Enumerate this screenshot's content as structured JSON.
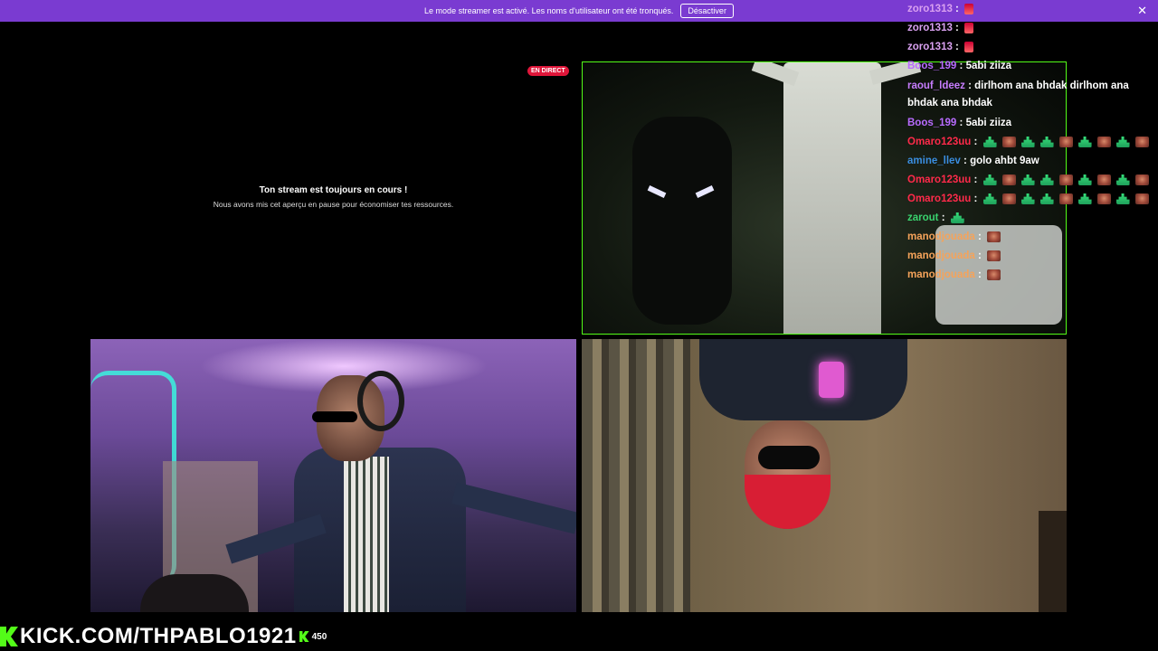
{
  "banner": {
    "text": "Le mode streamer est activé. Les noms d'utilisateur ont été tronqués.",
    "button": "Désactiver",
    "close": "✕",
    "color": "#7a3bd1"
  },
  "live_badge": "EN DIRECT",
  "paused": {
    "title": "Ton stream est toujours en cours !",
    "subtitle": "Nous avons mis cet aperçu en pause pour économiser tes ressources."
  },
  "chat": {
    "messages": [
      {
        "user": "zoro1313",
        "color": "#d9a0f0",
        "text": "",
        "emotes": [
          "red"
        ]
      },
      {
        "user": "zoro1313",
        "color": "#d9a0f0",
        "text": "",
        "emotes": [
          "red"
        ]
      },
      {
        "user": "zoro1313",
        "color": "#d9a0f0",
        "text": "",
        "emotes": [
          "red"
        ]
      },
      {
        "user": "Boos_199",
        "color": "#b86bff",
        "text": "5abi ziiza",
        "emotes": []
      },
      {
        "user": "raouf_ldeez",
        "color": "#c77dff",
        "text": "dirlhom ana bhdak dirlhom ana bhdak ana bhdak",
        "emotes": [],
        "wrap": true
      },
      {
        "user": "Boos_199",
        "color": "#b86bff",
        "text": "5abi ziiza",
        "emotes": []
      },
      {
        "user": "Omaro123uu",
        "color": "#ff2a4a",
        "text": "",
        "emotes": [
          "green",
          "face",
          "green",
          "green",
          "face",
          "green",
          "face",
          "green",
          "face"
        ]
      },
      {
        "user": "amine_llev",
        "color": "#3a8ddf",
        "text": "golo ahbt 9aw",
        "emotes": []
      },
      {
        "user": "Omaro123uu",
        "color": "#ff2a4a",
        "text": "",
        "emotes": [
          "green",
          "face",
          "green",
          "green",
          "face",
          "green",
          "face",
          "green",
          "face"
        ]
      },
      {
        "user": "Omaro123uu",
        "color": "#ff2a4a",
        "text": "",
        "emotes": [
          "green",
          "face",
          "green",
          "green",
          "face",
          "green",
          "face",
          "green",
          "face"
        ]
      },
      {
        "user": "zarout",
        "color": "#39d26e",
        "text": "",
        "emotes": [
          "green"
        ]
      },
      {
        "user": "manodjouada",
        "color": "#f5a35a",
        "text": "",
        "emotes": [
          "face"
        ]
      },
      {
        "user": "manodjouada",
        "color": "#f5a35a",
        "text": "",
        "emotes": [
          "face"
        ]
      },
      {
        "user": "manodjouada",
        "color": "#f5a35a",
        "text": "",
        "emotes": [
          "face"
        ]
      }
    ]
  },
  "footer": {
    "url": "KICK.COM/THPABLO1921",
    "viewer_count": "450",
    "brand_color": "#53fc18"
  }
}
